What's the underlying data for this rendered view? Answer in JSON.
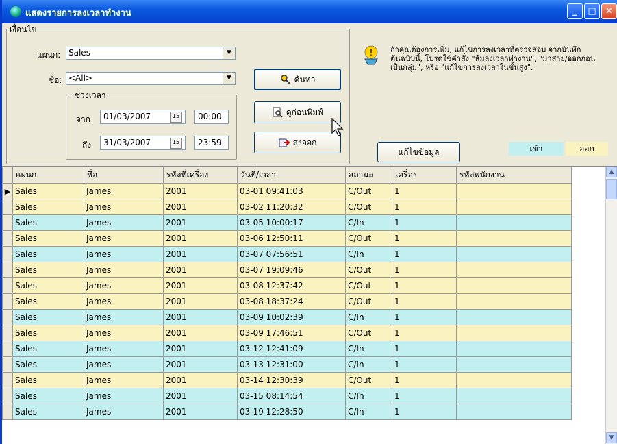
{
  "window": {
    "title": "แสดงรายการลงเวลาทำงาน",
    "minimize": "_",
    "maximize": "□",
    "close": "✕"
  },
  "filters": {
    "group_label": "เงื่อนไข",
    "department_label": "แผนก:",
    "department_value": "Sales",
    "name_label": "ชื่อ:",
    "name_value": "<All>",
    "period_label": "ช่วงเวลา",
    "from_label": "จาก",
    "from_date": "01/03/2007",
    "from_time": "00:00",
    "to_label": "ถึง",
    "to_date": "31/03/2007",
    "to_time": "23:59"
  },
  "buttons": {
    "search": "ค้นหา",
    "preview": "ดูก่อนพิมพ์",
    "export": "ส่งออก",
    "edit": "แก้ไขข้อมูล"
  },
  "info_text": "ถ้าคุณต้องการเพิ่ม, แก้ไขการลงเวลาที่ตรวจสอบ จากบันทึกต้นฉบับนี้, โปรดใช้คำสั่ง \"ลืมลงเวลาทำงาน\", \"มาสาย/ออกก่อนเป็นกลุ่ม\", หรือ \"แก้ไขการลงเวลาในขั้นสูง\".",
  "legend": {
    "in": "เข้า",
    "out": "ออก",
    "in_color": "#c2f0f0",
    "out_color": "#fbf3bf"
  },
  "table": {
    "columns": [
      "แผนก",
      "ชื่อ",
      "รหัสที่เครื่อง",
      "วันที่/เวลา",
      "สถานะ",
      "เครื่อง",
      "รหัสพนักงาน"
    ],
    "rows": [
      [
        "Sales",
        "James",
        "2001",
        "03-01 09:41:03",
        "C/Out",
        "1",
        ""
      ],
      [
        "Sales",
        "James",
        "2001",
        "03-02 11:20:32",
        "C/Out",
        "1",
        ""
      ],
      [
        "Sales",
        "James",
        "2001",
        "03-05 10:00:17",
        "C/In",
        "1",
        ""
      ],
      [
        "Sales",
        "James",
        "2001",
        "03-06 12:50:11",
        "C/Out",
        "1",
        ""
      ],
      [
        "Sales",
        "James",
        "2001",
        "03-07 07:56:51",
        "C/In",
        "1",
        ""
      ],
      [
        "Sales",
        "James",
        "2001",
        "03-07 19:09:46",
        "C/Out",
        "1",
        ""
      ],
      [
        "Sales",
        "James",
        "2001",
        "03-08 12:37:42",
        "C/Out",
        "1",
        ""
      ],
      [
        "Sales",
        "James",
        "2001",
        "03-08 18:37:24",
        "C/Out",
        "1",
        ""
      ],
      [
        "Sales",
        "James",
        "2001",
        "03-09 10:02:39",
        "C/In",
        "1",
        ""
      ],
      [
        "Sales",
        "James",
        "2001",
        "03-09 17:46:51",
        "C/Out",
        "1",
        ""
      ],
      [
        "Sales",
        "James",
        "2001",
        "03-12 12:41:09",
        "C/In",
        "1",
        ""
      ],
      [
        "Sales",
        "James",
        "2001",
        "03-13 12:31:00",
        "C/In",
        "1",
        ""
      ],
      [
        "Sales",
        "James",
        "2001",
        "03-14 12:30:39",
        "C/Out",
        "1",
        ""
      ],
      [
        "Sales",
        "James",
        "2001",
        "03-15 08:14:54",
        "C/In",
        "1",
        ""
      ],
      [
        "Sales",
        "James",
        "2001",
        "03-19 12:28:50",
        "C/In",
        "1",
        ""
      ]
    ]
  }
}
